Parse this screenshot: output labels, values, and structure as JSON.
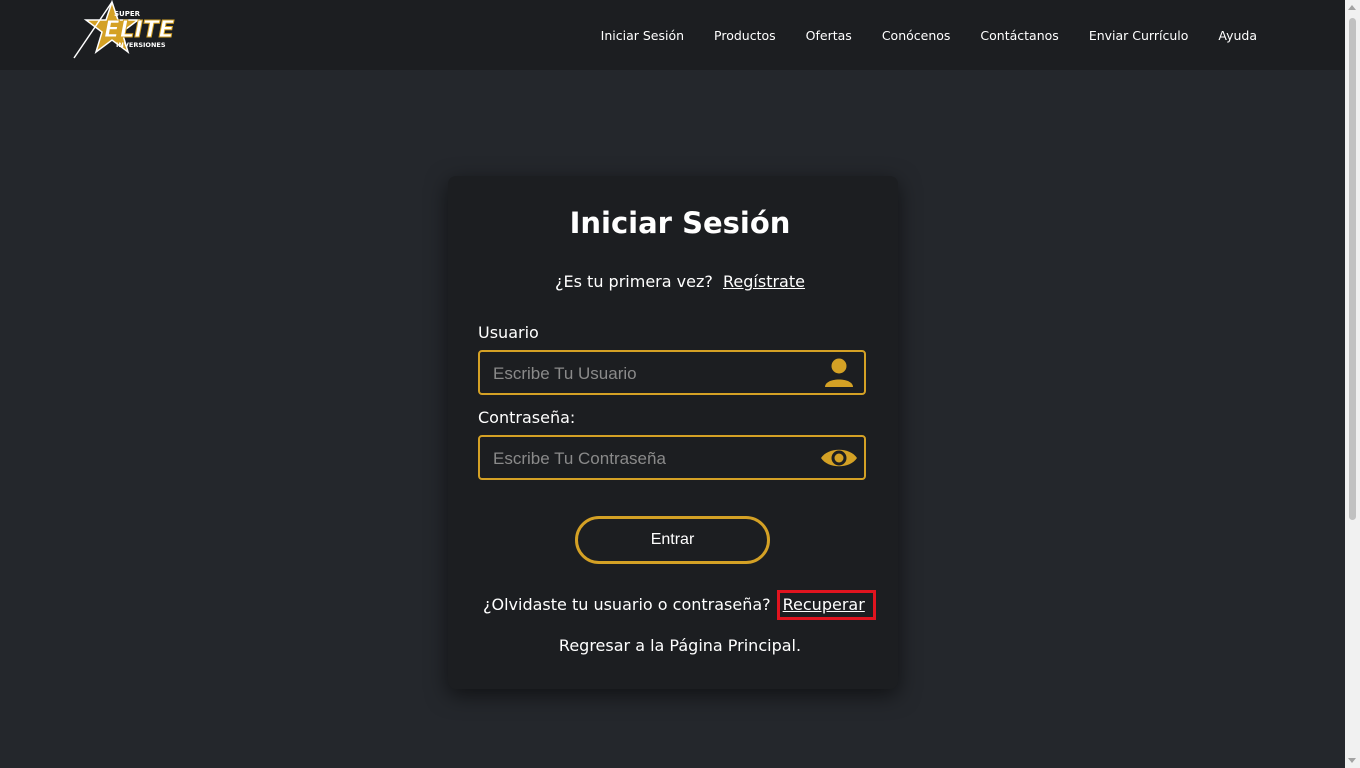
{
  "nav": {
    "logo": {
      "top": "SUPER",
      "main": "ELITE",
      "sub": "INVERSIONES"
    },
    "links": [
      "Iniciar Sesión",
      "Productos",
      "Ofertas",
      "Conócenos",
      "Contáctanos",
      "Enviar Currículo",
      "Ayuda"
    ]
  },
  "login": {
    "title": "Iniciar Sesión",
    "first_time_text": "¿Es tu primera vez?",
    "register_link": "Regístrate",
    "username_label": "Usuario",
    "username_placeholder": "Escribe Tu Usuario",
    "password_label": "Contraseña:",
    "password_placeholder": "Escribe Tu Contraseña",
    "submit_label": "Entrar",
    "forgot_text": "¿Olvidaste tu usuario o contraseña?",
    "recover_link": "Recuperar",
    "back_link": "Regresar a la Página Principal."
  },
  "icons": {
    "username": "user-icon",
    "password": "eye-icon"
  },
  "colors": {
    "accent": "#d4a125",
    "highlight": "#e0141f",
    "background": "#24272c",
    "panel": "#1c1e21"
  }
}
